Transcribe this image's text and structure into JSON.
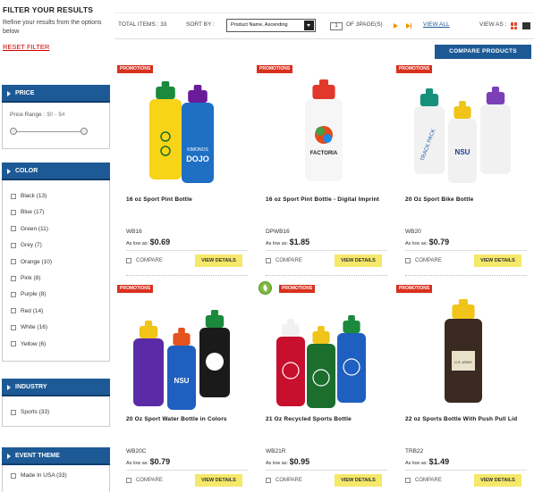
{
  "sidebar": {
    "title": "FILTER YOUR RESULTS",
    "description": "Refine your results from the options below",
    "reset_label": "RESET FILTER",
    "price": {
      "heading": "PRICE",
      "range_label": "Price Range :",
      "range_values": "$0 - $4"
    },
    "color": {
      "heading": "COLOR",
      "items": [
        {
          "label": "Black (13)"
        },
        {
          "label": "Blue (17)"
        },
        {
          "label": "Green (11)"
        },
        {
          "label": "Grey (7)"
        },
        {
          "label": "Orange (10)"
        },
        {
          "label": "Pink (8)"
        },
        {
          "label": "Purple (8)"
        },
        {
          "label": "Red (14)"
        },
        {
          "label": "White (16)"
        },
        {
          "label": "Yellow (6)"
        }
      ]
    },
    "industry": {
      "heading": "INDUSTRY",
      "items": [
        {
          "label": "Sports (33)"
        }
      ]
    },
    "event_theme": {
      "heading": "EVENT THEME",
      "items": [
        {
          "label": "Made In USA (33)"
        }
      ]
    }
  },
  "toolbar": {
    "total_items": "TOTAL ITEMS : 33",
    "sort_label": "SORT BY :",
    "sort_value": "Product Name, Ascending",
    "page_value": "1",
    "page_of": "OF 3PAGE(S)",
    "view_all": "VIEW ALL",
    "view_as": "VIEW AS :"
  },
  "compare_button": "COMPARE PRODUCTS",
  "products": [
    {
      "promo": "PROMOTIONS",
      "title": "16 oz Sport Pint Bottle",
      "sku": "WB16",
      "as_low_as": "As low as:",
      "price": "$0.69",
      "compare": "COMPARE",
      "view": "VIEW DETAILS",
      "eco": false
    },
    {
      "promo": "PROMOTIONS",
      "title": "16 oz Sport Pint Bottle - Digital Imprint",
      "sku": "DPWB16",
      "as_low_as": "As low as:",
      "price": "$1.85",
      "compare": "COMPARE",
      "view": "VIEW DETAILS",
      "eco": false
    },
    {
      "promo": "PROMOTIONS",
      "title": "20 Oz Sport Bike Bottle",
      "sku": "WB20",
      "as_low_as": "As low as:",
      "price": "$0.79",
      "compare": "COMPARE",
      "view": "VIEW DETAILS",
      "eco": false
    },
    {
      "promo": "PROMOTIONS",
      "title": "20 Oz Sport Water Bottle in Colors",
      "sku": "WB20C",
      "as_low_as": "As low as:",
      "price": "$0.79",
      "compare": "COMPARE",
      "view": "VIEW DETAILS",
      "eco": false
    },
    {
      "promo": "PROMOTIONS",
      "title": "21 Oz Recycled Sports Bottle",
      "sku": "WB21R",
      "as_low_as": "As low as:",
      "price": "$0.95",
      "compare": "COMPARE",
      "view": "VIEW DETAILS",
      "eco": true
    },
    {
      "promo": "PROMOTIONS",
      "title": "22 oz Sports Bottle With Push Pull Lid",
      "sku": "TRB22",
      "as_low_as": "As low as:",
      "price": "$1.49",
      "compare": "COMPARE",
      "view": "VIEW DETAILS",
      "eco": false
    }
  ],
  "image_text": {
    "dojo": "DOJO",
    "kimono": "KIMONOS",
    "factoria": "FACTORIA",
    "nsu": "NSU",
    "track_pack": "TRACK PACK",
    "army": "U.S. ARMY"
  },
  "colors": {
    "brand_blue": "#1d5a95",
    "promo_red": "#d9301d",
    "view_details_yellow": "#f5e86a",
    "reset_red": "#cc0000"
  }
}
